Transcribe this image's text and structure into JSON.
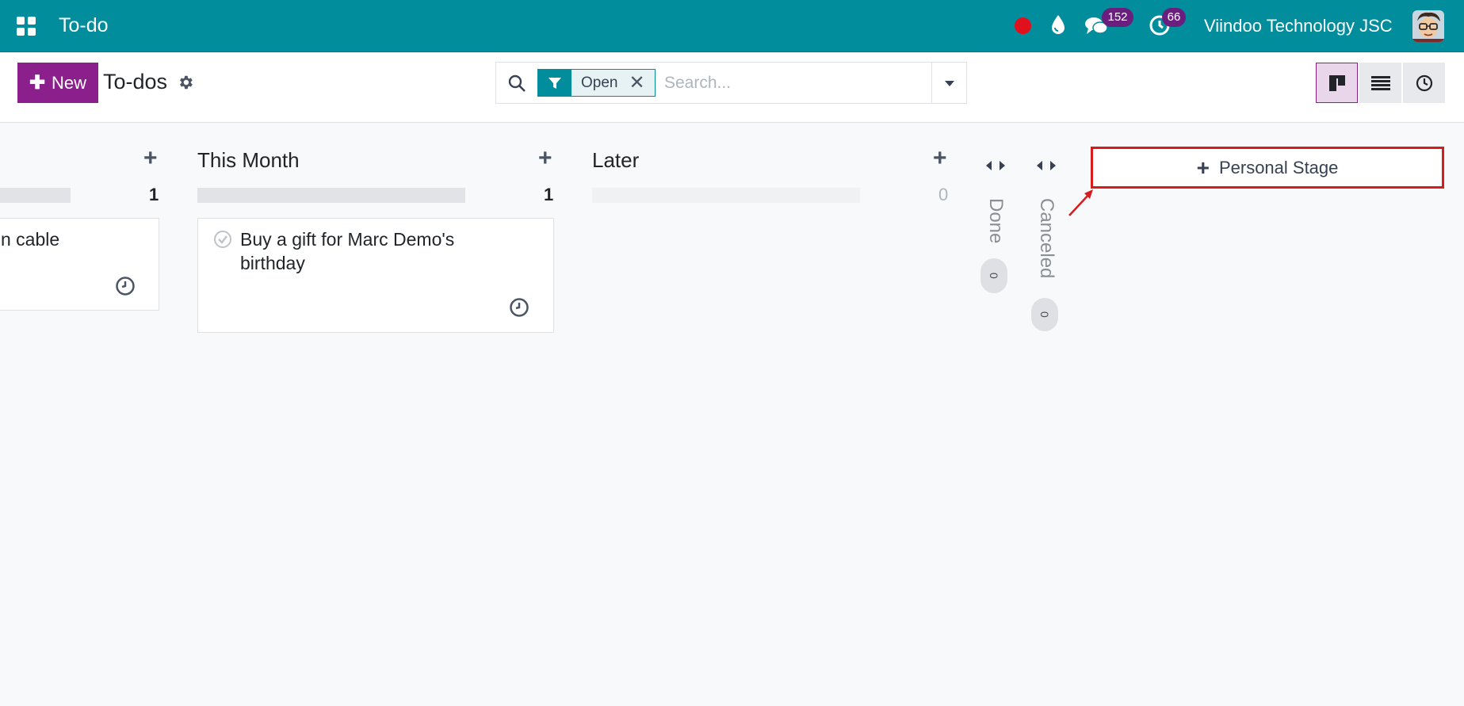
{
  "navbar": {
    "app_title": "To-do",
    "company": "Viindoo Technology JSC",
    "messages_count": "152",
    "activities_count": "66",
    "icons": [
      "apps-grid-icon",
      "record-dot-icon",
      "drop-icon",
      "chat-icon",
      "activity-clock-icon"
    ]
  },
  "control": {
    "new_label": "New",
    "page_title": "To-dos",
    "facet_label": "Open",
    "search_placeholder": "Search..."
  },
  "columns": [
    {
      "title": "",
      "count": "1",
      "progress": 1
    },
    {
      "title": "This Month",
      "count": "1",
      "progress": 1
    },
    {
      "title": "Later",
      "count": "0",
      "progress": 0
    }
  ],
  "cards": [
    {
      "title": "n cable"
    },
    {
      "title_line1": "Buy a gift for Marc Demo's",
      "title_line2": "birthday"
    }
  ],
  "folded_columns": [
    {
      "label": "Done",
      "count": "0"
    },
    {
      "label": "Canceled",
      "count": "0"
    }
  ],
  "add_stage_label": "Personal Stage",
  "colors": {
    "navbar": "#018d9c",
    "primary": "#8b1f8b",
    "annotation": "#d81b1b"
  }
}
